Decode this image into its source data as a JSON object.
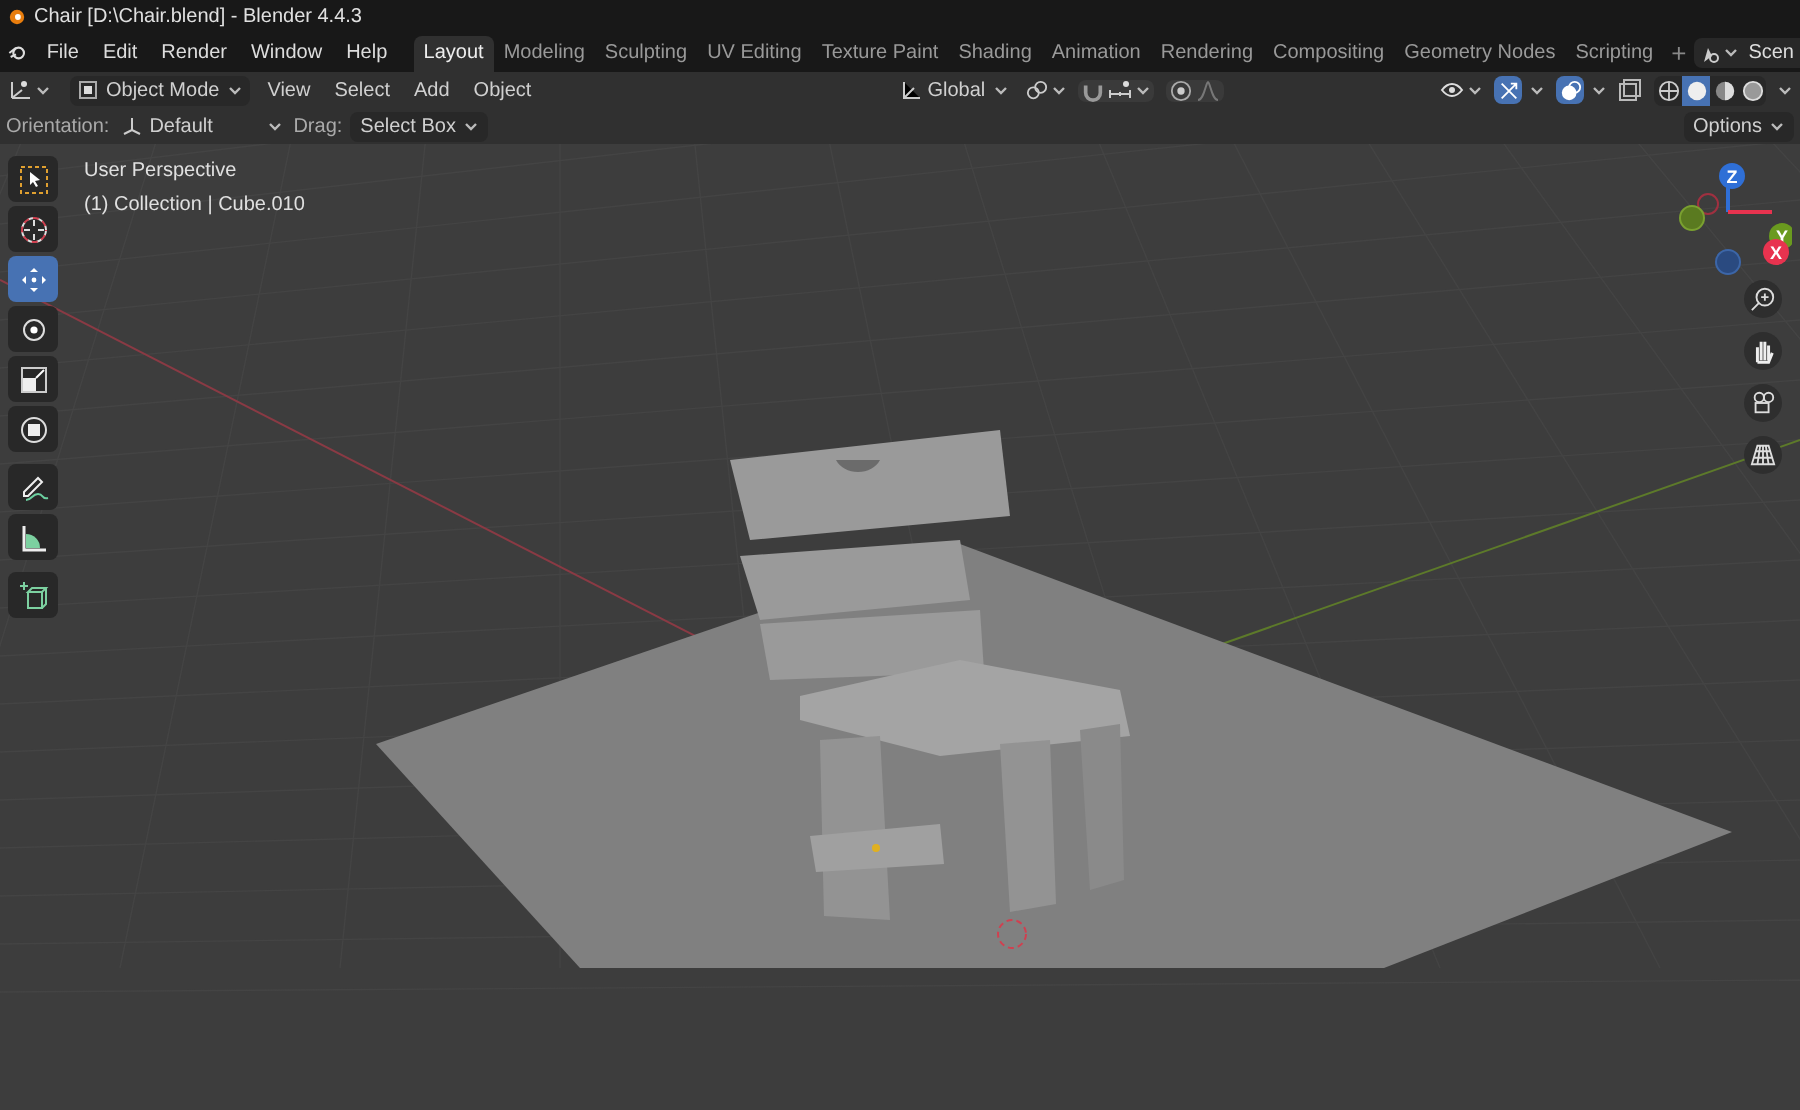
{
  "window": {
    "title": "Chair [D:\\Chair.blend] - Blender 4.4.3"
  },
  "menu": [
    "File",
    "Edit",
    "Render",
    "Window",
    "Help"
  ],
  "workspaces": [
    {
      "label": "Layout",
      "selected": true
    },
    {
      "label": "Modeling",
      "selected": false
    },
    {
      "label": "Sculpting",
      "selected": false
    },
    {
      "label": "UV Editing",
      "selected": false
    },
    {
      "label": "Texture Paint",
      "selected": false
    },
    {
      "label": "Shading",
      "selected": false
    },
    {
      "label": "Animation",
      "selected": false
    },
    {
      "label": "Rendering",
      "selected": false
    },
    {
      "label": "Compositing",
      "selected": false
    },
    {
      "label": "Geometry Nodes",
      "selected": false
    },
    {
      "label": "Scripting",
      "selected": false
    }
  ],
  "add_workspace": "+",
  "scene": "Scen",
  "header": {
    "mode": "Object Mode",
    "menus": [
      "View",
      "Select",
      "Add",
      "Object"
    ],
    "orientation": "Global"
  },
  "shading_modes": [
    {
      "kind": "wireframe",
      "selected": false
    },
    {
      "kind": "solid",
      "selected": true
    },
    {
      "kind": "material",
      "selected": false
    },
    {
      "kind": "rendered",
      "selected": false
    }
  ],
  "tool_settings": {
    "orientation_label": "Orientation:",
    "orientation": "Default",
    "drag_label": "Drag:",
    "drag": "Select Box",
    "options": "Options"
  },
  "viewport": {
    "view_name": "User Perspective",
    "object_info": "(1) Collection | Cube.010"
  },
  "tools": [
    {
      "kind": "select",
      "selected": false
    },
    {
      "kind": "cursor",
      "selected": false
    },
    {
      "kind": "move",
      "selected": true
    },
    {
      "kind": "rotate",
      "selected": false
    },
    {
      "kind": "scale",
      "selected": false
    },
    {
      "kind": "transform",
      "selected": false
    },
    {
      "kind": "annotate",
      "selected": false
    },
    {
      "kind": "measure",
      "selected": false
    },
    {
      "kind": "add_cube",
      "selected": false
    }
  ],
  "gizmo_axes": [
    {
      "label": "Z",
      "color": "#2f6fd6"
    },
    {
      "label": "Y",
      "color": "#6a9a1f"
    },
    {
      "label": "X",
      "color": "#e8334f"
    }
  ]
}
